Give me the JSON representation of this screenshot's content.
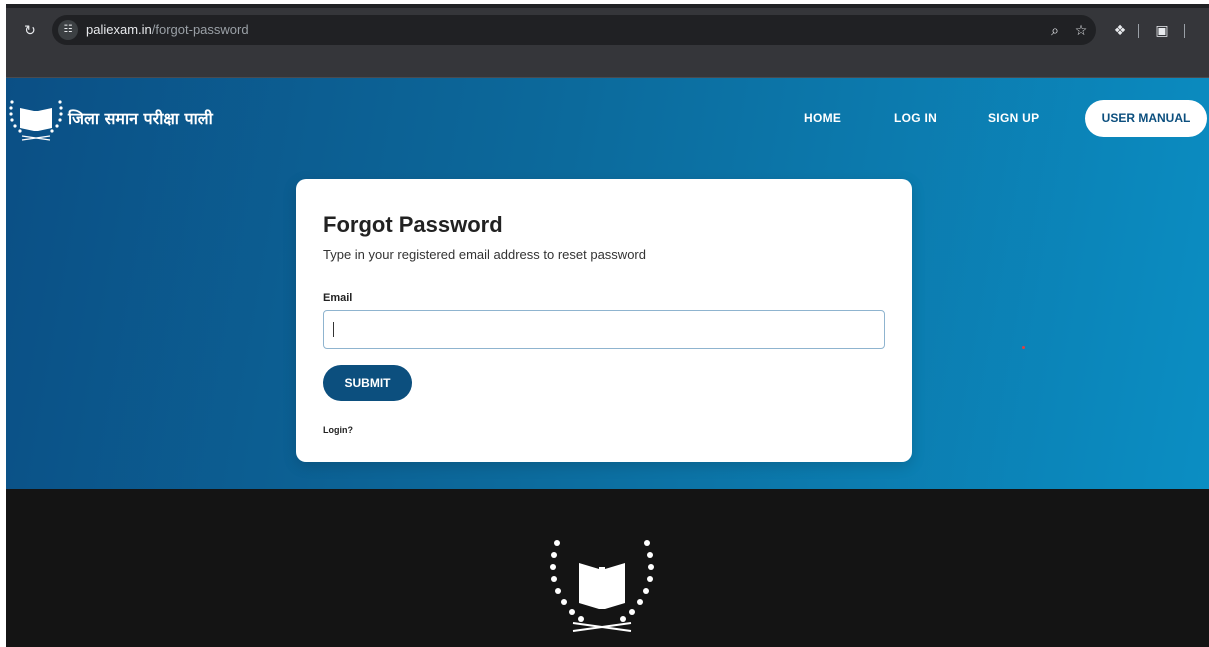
{
  "browser": {
    "url_host": "paliexam.in",
    "url_path": "/forgot-password",
    "icons": [
      "reload-icon",
      "site-info-icon",
      "zoom-icon",
      "bookmark-star-icon",
      "extensions-icon",
      "side-panel-icon"
    ]
  },
  "header": {
    "site_title": "जिला समान परीक्षा पाली",
    "nav": {
      "home": "HOME",
      "login": "LOG IN",
      "signup": "SIGN UP",
      "user_manual": "USER MANUAL"
    }
  },
  "form": {
    "title": "Forgot Password",
    "subtitle": "Type in your registered email address to reset password",
    "email_label": "Email",
    "email_value": "",
    "submit_label": "SUBMIT",
    "login_link": "Login?"
  },
  "colors": {
    "primary": "#0c4f7e",
    "hero_start": "#0b4f85",
    "hero_end": "#0b8ec3",
    "footer": "#141414"
  }
}
